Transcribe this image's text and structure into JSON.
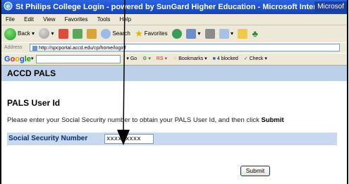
{
  "window": {
    "title": "St Philips College Login - powered by SunGard Higher Education - Microsoft Internet Explorer",
    "taskbar_text": "Microsof"
  },
  "menu": [
    "File",
    "Edit",
    "View",
    "Favorites",
    "Tools",
    "Help"
  ],
  "toolbar": {
    "back_label": "Back",
    "search_label": "Search",
    "favorites_label": "Favorites"
  },
  "address": {
    "label": "Address",
    "url": "http://spcportal.accd.edu/cp/home/loginf"
  },
  "google_bar": {
    "logo": [
      "G",
      "o",
      "o",
      "g",
      "le"
    ],
    "go_label": "Go",
    "bookmarks_label": "Bookmarks",
    "blocked_label": "4 blocked",
    "check_label": "Check"
  },
  "page": {
    "header": "ACCD PALS",
    "title": "PALS User Id",
    "instructions_prefix": "Please enter your Social Security number to obtain your PALS User Id, and then click",
    "instructions_bold": "Submit",
    "ssn_label": "Social Security Number",
    "ssn_value": "xxxxxxxxx",
    "submit_label": "Submit"
  },
  "colors": {
    "titlebar": "#1b4fc6",
    "header_band": "#bcd0ea",
    "field_band": "#c7d8ef"
  }
}
